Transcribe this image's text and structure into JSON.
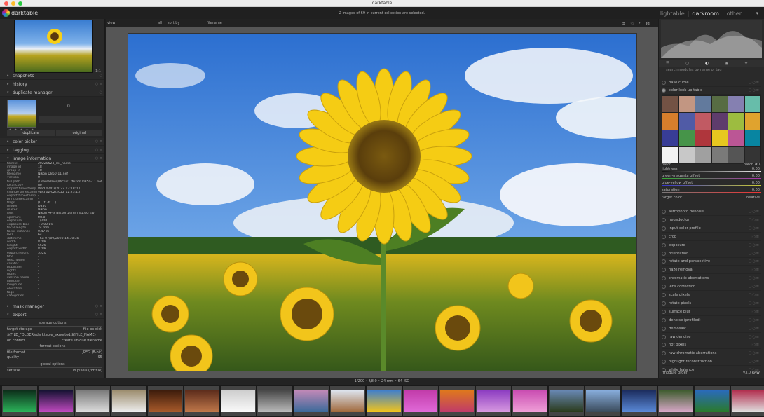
{
  "window": {
    "title": "darktable",
    "app_name": "darktable"
  },
  "header": {
    "selection_info": "2 images of 69 in current collection are selected.",
    "views": [
      "lightable",
      "darkroom",
      "other"
    ],
    "active_view": "darkroom"
  },
  "center_toolbar": {
    "view": "view",
    "all": "all",
    "sort_by": "sort by",
    "filename": "filename"
  },
  "left": {
    "nav_zoom": "1:1",
    "modules": {
      "snapshots": "snapshots",
      "history": "history",
      "duplicate_manager": "duplicate manager",
      "color_picker": "color picker",
      "tagging": "tagging",
      "image_information": "image information",
      "mask_manager": "mask manager",
      "export": "export"
    },
    "duplicate": {
      "count": "0",
      "btn_duplicate": "duplicate",
      "btn_original": "original",
      "stars": "★ ★ ★ ★ ★"
    },
    "info": [
      [
        "filmroll",
        "20220523_rni_name"
      ],
      [
        "image id",
        "18"
      ],
      [
        "group id",
        "18"
      ],
      [
        "filename",
        "Nikon D850-11.nef"
      ],
      [
        "version",
        "0"
      ],
      [
        "full path",
        "/Users/david/Pictur.../Nikon D850-11.nef"
      ],
      [
        "local copy",
        "no"
      ],
      [
        "import timestamp",
        "Wed 02/02/2022 12:18:03"
      ],
      [
        "change timestamp",
        "Wed 02/02/2022 12:23:13"
      ],
      [
        "export timestamp",
        "-"
      ],
      [
        "print timestamp",
        "-"
      ],
      [
        "flags",
        "[L...t..dt....]"
      ],
      [
        "model",
        "D850"
      ],
      [
        "maker",
        "Nikon"
      ],
      [
        "lens",
        "Nikon AF-S Nikkor 24mm f/1.4G ED"
      ],
      [
        "aperture",
        "f/8.0"
      ],
      [
        "exposure",
        "1/200"
      ],
      [
        "exposure bias",
        "+0.00 EV"
      ],
      [
        "focal length",
        "24 mm"
      ],
      [
        "focus distance",
        "0.47 m"
      ],
      [
        "ISO",
        "64"
      ],
      [
        "datetime",
        "Thu 07/09/2020 14:30:38"
      ],
      [
        "width",
        "8288"
      ],
      [
        "height",
        "5520"
      ],
      [
        "export width",
        "8288"
      ],
      [
        "export height",
        "5520"
      ],
      [
        "title",
        "-"
      ],
      [
        "description",
        "-"
      ],
      [
        "creator",
        "-"
      ],
      [
        "publisher",
        "-"
      ],
      [
        "rights",
        "-"
      ],
      [
        "notes",
        "-"
      ],
      [
        "version name",
        "-"
      ],
      [
        "latitude",
        "-"
      ],
      [
        "longitude",
        "-"
      ],
      [
        "elevation",
        "-"
      ],
      [
        "tags",
        "-"
      ],
      [
        "categories",
        "-"
      ]
    ],
    "export": {
      "storage_options": "storage options",
      "target_storage": "target storage",
      "target_storage_val": "file on disk",
      "path": "$(FILE_FOLDER)/darktable_exported/$(FILE_NAME)",
      "on_conflict": "on conflict",
      "on_conflict_val": "create unique filename",
      "format_options": "format options",
      "file_format": "file format",
      "file_format_val": "JPEG (8-bit)",
      "quality": "quality",
      "quality_val": "95",
      "global_options": "global options",
      "set_size": "set size",
      "set_size_val": "in pixels (for file)",
      "w": "0",
      "x": "x",
      "h": "0",
      "px": "px",
      "allow_upscaling": "allow upscaling",
      "allow_upscaling_val": "no"
    }
  },
  "right": {
    "search_placeholder": "search modules by name or tag",
    "base_curve": "base curve",
    "color_lookup": "color look up table",
    "patch_label": "patch",
    "patch_val": "patch #0",
    "lightness": "lightness",
    "lightness_val": "0.00",
    "green_magenta": "green-magenta offset",
    "green_magenta_val": "0.00",
    "blue_yellow": "blue-yellow offset",
    "blue_yellow_val": "0.00",
    "saturation": "saturation",
    "saturation_val": "0.00",
    "target_color": "target color",
    "target_color_val": "relative",
    "modules": [
      "astrophoto denoise",
      "negadoctor",
      "input color profile",
      "crop",
      "exposure",
      "orientation",
      "rotate and perspective",
      "haze removal",
      "chromatic aberrations",
      "lens correction",
      "scale pixels",
      "rotate pixels",
      "surface blur",
      "denoise (profiled)",
      "demosaic",
      "raw denoise",
      "hot pixels",
      "raw chromatic aberrations",
      "highlight reconstruction",
      "white balance"
    ],
    "module_order": "module order",
    "module_order_val": "v3.0 RAW",
    "lut_colors": [
      "#735244",
      "#c29682",
      "#627a9d",
      "#576c43",
      "#8580b1",
      "#67bdaa",
      "#d67e2c",
      "#505ba6",
      "#c15a63",
      "#5e3c6c",
      "#9dbc40",
      "#e0a32e",
      "#383d96",
      "#469449",
      "#af363c",
      "#e7c71f",
      "#bb5695",
      "#0885a1",
      "#f3f3f2",
      "#c8c8c8",
      "#a0a0a0",
      "#7a7a79",
      "#555555",
      "#343434"
    ]
  },
  "filmstrip": {
    "exif": "1/200 • f/8.0 • 24 mm • 64 ISO"
  }
}
